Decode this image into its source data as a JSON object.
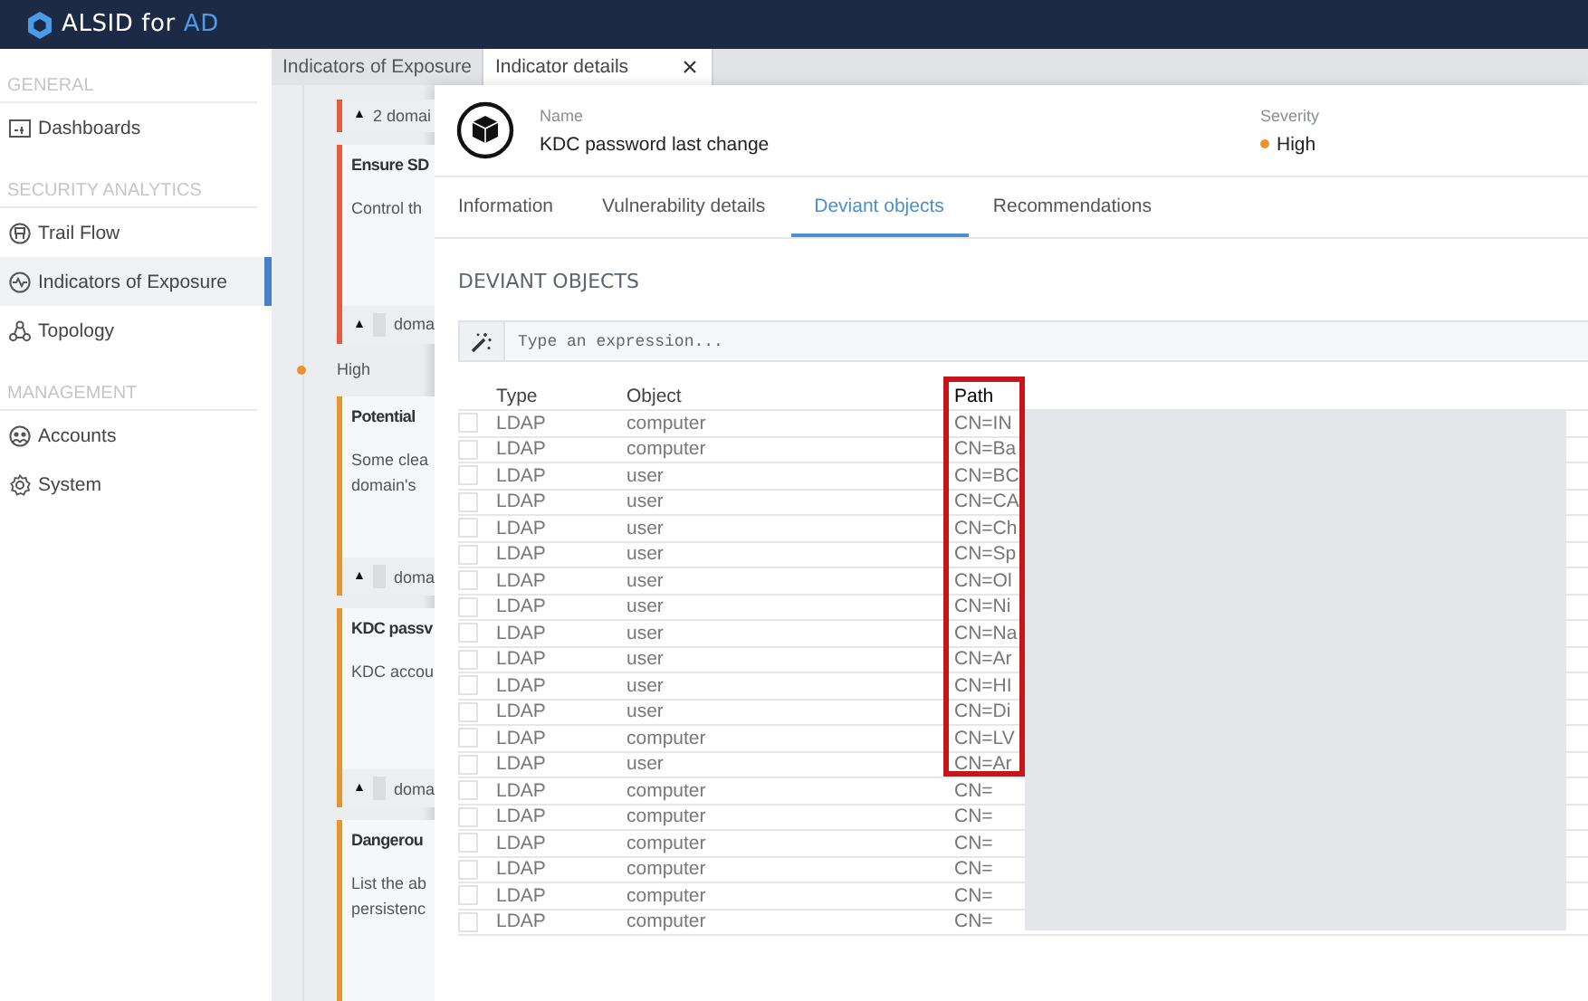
{
  "topbar": {
    "brand": "ALSID for",
    "brand_accent": "AD"
  },
  "sidebar": {
    "sections": [
      {
        "title": "GENERAL",
        "items": [
          {
            "label": "Dashboards",
            "selected": false
          }
        ]
      },
      {
        "title": "SECURITY ANALYTICS",
        "items": [
          {
            "label": "Trail Flow",
            "selected": false
          },
          {
            "label": "Indicators of Exposure",
            "selected": true
          },
          {
            "label": "Topology",
            "selected": false
          }
        ]
      },
      {
        "title": "MANAGEMENT",
        "items": [
          {
            "label": "Accounts",
            "selected": false
          },
          {
            "label": "System",
            "selected": false
          }
        ]
      }
    ]
  },
  "page_tabs": [
    {
      "label": "Indicators of Exposure",
      "selected": false,
      "closable": false
    },
    {
      "label": "Indicator details",
      "selected": true,
      "closable": true
    }
  ],
  "indicator_list": [
    {
      "kind": "footer",
      "color": "#e25d3f",
      "arrow": "▲",
      "footer": "2 domai",
      "redacted": false
    },
    {
      "kind": "card",
      "color": "#e25d3f",
      "title": "Ensure SD",
      "description": [
        "Control th"
      ],
      "arrow": "▲",
      "footer": "doma",
      "redacted": true
    },
    {
      "kind": "level",
      "color": "#e8952f",
      "label": "High"
    },
    {
      "kind": "card",
      "color": "#e8952f",
      "title": "Potential",
      "description": [
        "Some clea",
        "domain's"
      ],
      "arrow": "▲",
      "footer": "doma",
      "redacted": true
    },
    {
      "kind": "card",
      "color": "#e8952f",
      "title": "KDC passv",
      "description": [
        "KDC accou"
      ],
      "arrow": "▲",
      "footer": "doma",
      "redacted": true
    },
    {
      "kind": "open",
      "color": "#e8952f",
      "title": "Dangerou",
      "description": [
        "List the ab",
        "persistenc"
      ]
    }
  ],
  "details": {
    "name_label": "Name",
    "name": "KDC password last change",
    "severity_label": "Severity",
    "severity": {
      "label": "High",
      "color": "#e8952f"
    },
    "tabs": [
      {
        "label": "Information",
        "selected": false
      },
      {
        "label": "Vulnerability details",
        "selected": false
      },
      {
        "label": "Deviant objects",
        "selected": true
      },
      {
        "label": "Recommendations",
        "selected": false
      }
    ],
    "section_title": "DEVIANT OBJECTS",
    "search": {
      "placeholder": "Type an expression..."
    },
    "table": {
      "columns": [
        {
          "label": "Type",
          "highlighted": false
        },
        {
          "label": "Object",
          "highlighted": false
        },
        {
          "label": "Path",
          "highlighted": true
        }
      ],
      "rows": [
        {
          "checked": false,
          "type": "LDAP",
          "object": "computer",
          "path": "CN=IN"
        },
        {
          "checked": false,
          "type": "LDAP",
          "object": "computer",
          "path": "CN=Ba"
        },
        {
          "checked": false,
          "type": "LDAP",
          "object": "user",
          "path": "CN=BC"
        },
        {
          "checked": false,
          "type": "LDAP",
          "object": "user",
          "path": "CN=CA"
        },
        {
          "checked": false,
          "type": "LDAP",
          "object": "user",
          "path": "CN=Ch"
        },
        {
          "checked": false,
          "type": "LDAP",
          "object": "user",
          "path": "CN=Sp"
        },
        {
          "checked": false,
          "type": "LDAP",
          "object": "user",
          "path": "CN=Ol"
        },
        {
          "checked": false,
          "type": "LDAP",
          "object": "user",
          "path": "CN=Ni"
        },
        {
          "checked": false,
          "type": "LDAP",
          "object": "user",
          "path": "CN=Na"
        },
        {
          "checked": false,
          "type": "LDAP",
          "object": "user",
          "path": "CN=Ar"
        },
        {
          "checked": false,
          "type": "LDAP",
          "object": "user",
          "path": "CN=HI"
        },
        {
          "checked": false,
          "type": "LDAP",
          "object": "user",
          "path": "CN=Di"
        },
        {
          "checked": false,
          "type": "LDAP",
          "object": "computer",
          "path": "CN=LV"
        },
        {
          "checked": false,
          "type": "LDAP",
          "object": "user",
          "path": "CN=Ar"
        },
        {
          "checked": false,
          "type": "LDAP",
          "object": "computer",
          "path": "CN="
        },
        {
          "checked": false,
          "type": "LDAP",
          "object": "computer",
          "path": "CN="
        },
        {
          "checked": false,
          "type": "LDAP",
          "object": "computer",
          "path": "CN="
        },
        {
          "checked": false,
          "type": "LDAP",
          "object": "computer",
          "path": "CN="
        },
        {
          "checked": false,
          "type": "LDAP",
          "object": "computer",
          "path": "CN="
        },
        {
          "checked": false,
          "type": "LDAP",
          "object": "computer",
          "path": "CN="
        }
      ]
    }
  }
}
